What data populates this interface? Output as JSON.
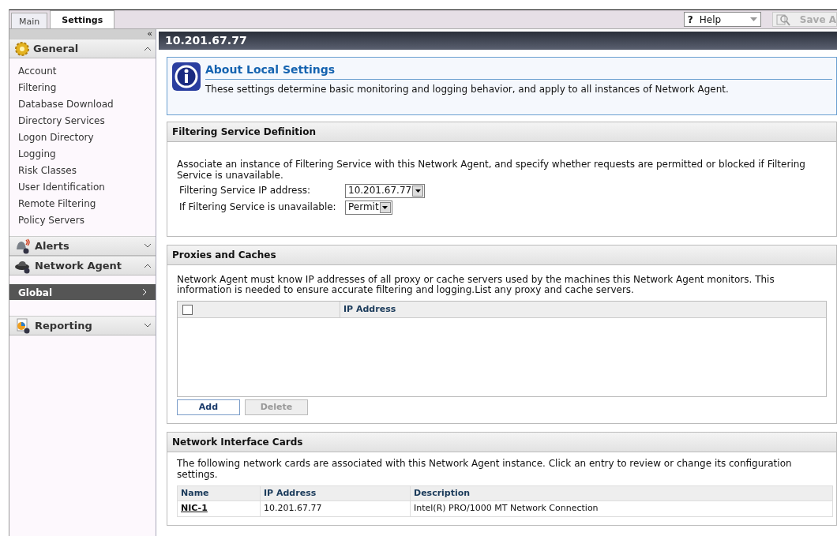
{
  "tabs": [
    {
      "label": "Main",
      "selected": false
    },
    {
      "label": "Settings",
      "selected": true
    }
  ],
  "toolbar": {
    "help": {
      "label": "Help",
      "icon_char": "?"
    },
    "save": {
      "label": "Save A",
      "disabled": true
    }
  },
  "sidebar": {
    "collapse_char": "«",
    "sections": [
      {
        "title": "General",
        "expanded": true,
        "items": [
          {
            "label": "Account",
            "selected": false
          },
          {
            "label": "Filtering",
            "selected": false
          },
          {
            "label": "Database Download",
            "selected": false
          },
          {
            "label": "Directory Services",
            "selected": false
          },
          {
            "label": "Logon Directory",
            "selected": false
          },
          {
            "label": "Logging",
            "selected": false
          },
          {
            "label": "Risk Classes",
            "selected": false
          },
          {
            "label": "User Identification",
            "selected": false
          },
          {
            "label": "Remote Filtering",
            "selected": false
          },
          {
            "label": "Policy Servers",
            "selected": false
          }
        ]
      },
      {
        "title": "Alerts",
        "expanded": false
      },
      {
        "title": "Network Agent",
        "expanded": true,
        "items": [
          {
            "label": "Global",
            "selected": true
          }
        ]
      },
      {
        "title": "Reporting",
        "expanded": false
      }
    ]
  },
  "page_title": "10.201.67.77",
  "about": {
    "title": "About Local Settings",
    "text": "These settings determine basic monitoring and logging behavior, and apply to all instances of Network Agent."
  },
  "filtering_service": {
    "title": "Filtering Service Definition",
    "text": "Associate an instance of Filtering Service with this Network Agent, and specify whether requests are permitted or blocked if Filtering Service is unavailable.",
    "fields": [
      {
        "label": "Filtering Service IP address:",
        "value": "10.201.67.77"
      },
      {
        "label": "If Filtering Service is unavailable:",
        "value": "Permit"
      }
    ]
  },
  "proxies": {
    "title": "Proxies and Caches",
    "text": "Network Agent must know IP addresses of all proxy or cache servers used by the machines this Network Agent monitors. This information is needed to ensure accurate filtering and logging.List any proxy and cache servers.",
    "columns": [
      "IP Address"
    ],
    "select_all_checked": false,
    "buttons": [
      {
        "label": "Add",
        "disabled": false
      },
      {
        "label": "Delete",
        "disabled": true
      }
    ]
  },
  "nics": {
    "title": "Network Interface Cards",
    "text": "The following network cards are associated with this Network Agent instance. Click an entry to review or change its configuration settings.",
    "columns": [
      "Name",
      "IP Address",
      "Description"
    ],
    "rows": [
      [
        "NIC-1",
        "10.201.67.77",
        "Intel(R) PRO/1000 MT Network Connection"
      ]
    ]
  }
}
